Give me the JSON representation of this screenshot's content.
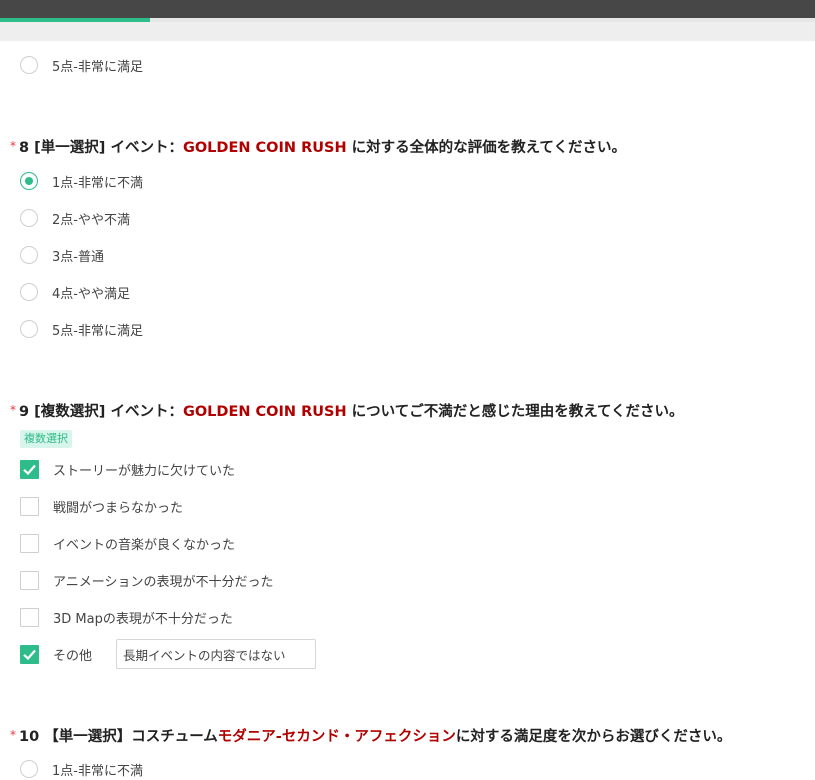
{
  "progress": {
    "percent": 18.4
  },
  "q7": {
    "partial_option": "5点-非常に満足"
  },
  "q8": {
    "required_mark": "*",
    "prefix": "8 [単一選択] イベント：",
    "highlight": "GOLDEN COIN RUSH",
    "suffix": " に対する全体的な評価を教えてください。",
    "options": [
      {
        "label": "1点-非常に不満",
        "selected": true
      },
      {
        "label": "2点-やや不満",
        "selected": false
      },
      {
        "label": "3点-普通",
        "selected": false
      },
      {
        "label": "4点-やや満足",
        "selected": false
      },
      {
        "label": "5点-非常に満足",
        "selected": false
      }
    ]
  },
  "q9": {
    "required_mark": "*",
    "prefix": "9 [複数選択] イベント：",
    "highlight": "GOLDEN COIN RUSH",
    "suffix": " についてご不満だと感じた理由を教えてください。",
    "tag": "複数選択",
    "options": [
      {
        "label": "ストーリーが魅力に欠けていた",
        "checked": true
      },
      {
        "label": "戦闘がつまらなかった",
        "checked": false
      },
      {
        "label": "イベントの音楽が良くなかった",
        "checked": false
      },
      {
        "label": "アニメーションの表現が不十分だった",
        "checked": false
      },
      {
        "label": "3D Mapの表現が不十分だった",
        "checked": false
      },
      {
        "label": "その他",
        "checked": true
      }
    ],
    "other_value": "長期イベントの内容ではない"
  },
  "q10": {
    "required_mark": "*",
    "prefix": "10 【単一選択】コスチューム",
    "highlight": "モダニア-セカンド・アフェクション",
    "suffix": "に対する満足度を次からお選びください。",
    "partial_option": "1点-非常に不満"
  },
  "colors": {
    "accent": "#2ebc8a",
    "highlight": "#b00000",
    "required": "#e4393c"
  }
}
